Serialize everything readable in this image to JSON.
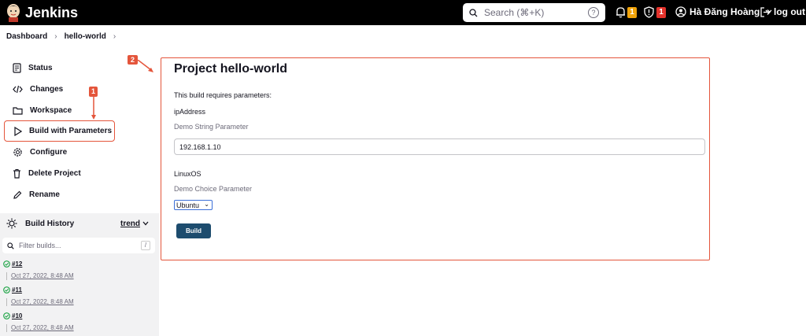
{
  "header": {
    "brand": "Jenkins",
    "search_placeholder": "Search (⌘+K)",
    "notifications_count": "1",
    "security_count": "1",
    "user_name": "Hà Đăng Hoàng",
    "logout_label": "log out",
    "colors": {
      "bar": "#000000",
      "notify_badge": "#f0a30a",
      "security_badge": "#e4322b"
    }
  },
  "breadcrumb": {
    "items": [
      "Dashboard",
      "hello-world"
    ]
  },
  "sidebar": {
    "items": [
      {
        "label": "Status",
        "icon": "document-icon"
      },
      {
        "label": "Changes",
        "icon": "code-icon"
      },
      {
        "label": "Workspace",
        "icon": "folder-icon"
      },
      {
        "label": "Build with Parameters",
        "icon": "play-icon"
      },
      {
        "label": "Configure",
        "icon": "gear-icon"
      },
      {
        "label": "Delete Project",
        "icon": "trash-icon"
      },
      {
        "label": "Rename",
        "icon": "pencil-icon"
      }
    ]
  },
  "annotations": {
    "one": "1",
    "two": "2",
    "color": "#e4553b"
  },
  "build_history": {
    "title": "Build History",
    "trend_label": "trend",
    "filter_placeholder": "Filter builds...",
    "filter_shortcut": "/",
    "builds": [
      {
        "number": "#12",
        "time": "Oct 27, 2022, 8:48 AM"
      },
      {
        "number": "#11",
        "time": "Oct 27, 2022, 8:48 AM"
      },
      {
        "number": "#10",
        "time": "Oct 27, 2022, 8:48 AM"
      }
    ]
  },
  "main": {
    "title": "Project hello-world",
    "requires_text": "This build requires parameters:",
    "params": [
      {
        "name": "ipAddress",
        "description": "Demo String Parameter",
        "value": "192.168.1.10"
      },
      {
        "name": "LinuxOS",
        "description": "Demo Choice Parameter",
        "value": "Ubuntu"
      }
    ],
    "build_button": "Build",
    "colors": {
      "build_button": "#1d4c6e",
      "highlight_border": "#e4553b"
    }
  }
}
